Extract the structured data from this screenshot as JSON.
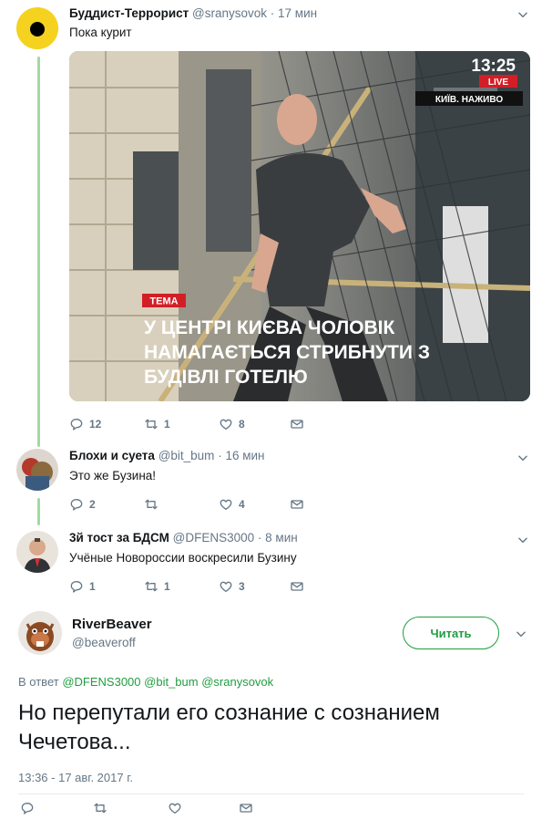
{
  "tweets": [
    {
      "name": "Буддист-Террорист",
      "handle": "@sranysovok",
      "time": "17 мин",
      "text": "Пока курит",
      "replies": "12",
      "retweets": "1",
      "likes": "8",
      "media": {
        "clock": "13:25",
        "live": "LIVE",
        "channel": "КИЇВ. НАЖИВО",
        "topic_tag": "ТЕМА",
        "headline_1": "У ЦЕНТРІ КИЄВА ЧОЛОВІК",
        "headline_2": "НАМАГАЄТЬСЯ СТРИБНУТИ З",
        "headline_3": "БУДІВЛІ ГОТЕЛЮ"
      }
    },
    {
      "name": "Блохи и суета",
      "handle": "@bit_bum",
      "time": "16 мин",
      "text": "Это же Бузина!",
      "replies": "2",
      "retweets": "",
      "likes": "4"
    },
    {
      "name": "3й тост за БДСМ",
      "handle": "@DFENS3000",
      "time": "8 мин",
      "text": "Учёные Новороссии воскресили  Бузину",
      "replies": "1",
      "retweets": "1",
      "likes": "3"
    }
  ],
  "main": {
    "name": "RiverBeaver",
    "handle": "@beaveroff",
    "follow_label": "Читать",
    "reply_prefix": "В ответ",
    "mentions": [
      "@DFENS3000",
      "@bit_bum",
      "@sranysovok"
    ],
    "text": "Но перепутали его сознание с сознанием Чечетова...",
    "date": "13:36 - 17 авг. 2017 г."
  },
  "separator": "·",
  "colors": {
    "accent": "#1f9e3f",
    "thread": "#a3d9a5",
    "muted": "#657786",
    "live": "#d21f26"
  },
  "icons": [
    "reply-icon",
    "retweet-icon",
    "like-icon",
    "dm-icon",
    "chevron-down-icon"
  ]
}
